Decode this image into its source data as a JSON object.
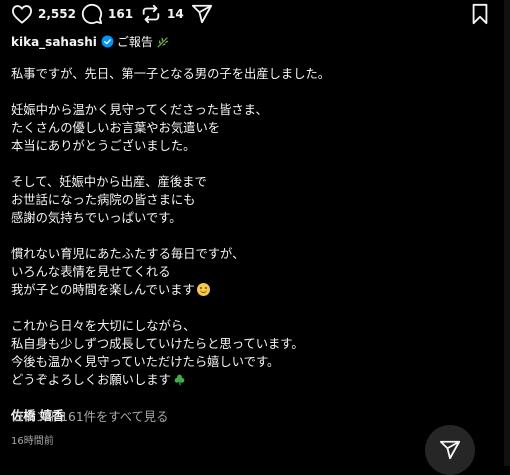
{
  "actions": {
    "likes": "2,552",
    "comments": "161",
    "reposts": "14"
  },
  "post": {
    "username": "kika_sahashi",
    "title": "ご報告",
    "paragraphs": [
      [
        "私事ですが、先日、第一子となる男の子を出産しました。"
      ],
      [
        "妊娠中から温かく見守ってくださった皆さま、",
        "たくさんの優しいお言葉やお気遣いを",
        "本当にありがとうございました。"
      ],
      [
        "そして、妊娠中から出産、産後まで",
        "お世話になった病院の皆さまにも",
        "感謝の気持ちでいっぱいです。"
      ],
      [
        "慣れない育児にあたふたする毎日ですが、",
        "いろんな表情を見せてくれる",
        "我が子との時間を楽しんでいます"
      ],
      [
        "これから日々を大切にしながら、",
        "私自身も少しずつ成長していけたらと思っています。",
        "今後も温かく見守っていただけたら嬉しいです。",
        "どうぞよろしくお願いします"
      ]
    ],
    "signature": "佐橋 嬉香",
    "view_comments": "コメント161件をすべて見る",
    "timestamp": "16時間前"
  },
  "icons": {
    "like": "heart-icon",
    "comment": "comment-bubble-icon",
    "repost": "repost-icon",
    "share": "send-icon",
    "save": "bookmark-icon",
    "verified": "verified-badge-icon"
  },
  "colors": {
    "background": "#000000",
    "text": "#f5f5f5",
    "muted": "#a8a8a8",
    "verified": "#0095f6"
  }
}
